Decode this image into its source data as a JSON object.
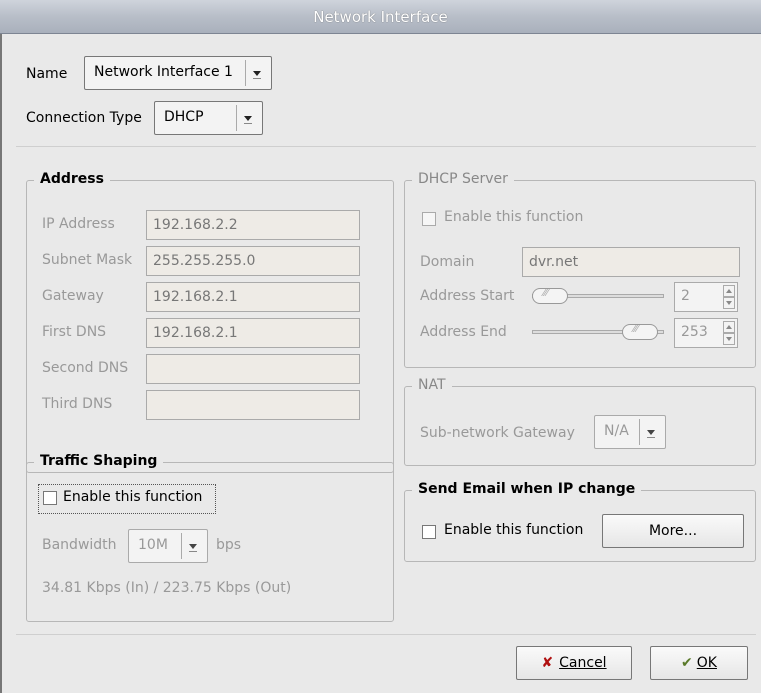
{
  "window": {
    "title": "Network Interface"
  },
  "top": {
    "name_label": "Name",
    "name_value": "Network Interface 1",
    "conn_label": "Connection Type",
    "conn_value": "DHCP"
  },
  "address": {
    "title": "Address",
    "rows": [
      {
        "label": "IP Address",
        "value": "192.168.2.2"
      },
      {
        "label": "Subnet Mask",
        "value": "255.255.255.0"
      },
      {
        "label": "Gateway",
        "value": "192.168.2.1"
      },
      {
        "label": "First DNS",
        "value": "192.168.2.1"
      },
      {
        "label": "Second DNS",
        "value": ""
      },
      {
        "label": "Third DNS",
        "value": ""
      }
    ]
  },
  "traffic": {
    "title": "Traffic Shaping",
    "enable_label": "Enable this function",
    "enabled": false,
    "bandwidth_label": "Bandwidth",
    "bandwidth_value": "10M",
    "bandwidth_unit": "bps",
    "rate_text": "34.81 Kbps (In) / 223.75 Kbps (Out)"
  },
  "dhcp": {
    "title": "DHCP Server",
    "enable_label": "Enable this function",
    "enabled": false,
    "domain_label": "Domain",
    "domain_value": "dvr.net",
    "start_label": "Address Start",
    "start_value": "2",
    "end_label": "Address End",
    "end_value": "253"
  },
  "nat": {
    "title": "NAT",
    "gateway_label": "Sub-network Gateway",
    "gateway_value": "N/A"
  },
  "email": {
    "title": "Send Email when IP change",
    "enable_label": "Enable this function",
    "enabled": false,
    "more_label": "More..."
  },
  "buttons": {
    "cancel_label": "Cancel",
    "ok_label": "OK"
  },
  "icons": {
    "combo_arrow": "chevron-down-icon",
    "cancel": "x-icon",
    "ok": "checkmark-hand-icon"
  },
  "colors": {
    "titlebar": "#b8bec8",
    "background": "#e9e9e9",
    "disabled_text": "#999999"
  }
}
